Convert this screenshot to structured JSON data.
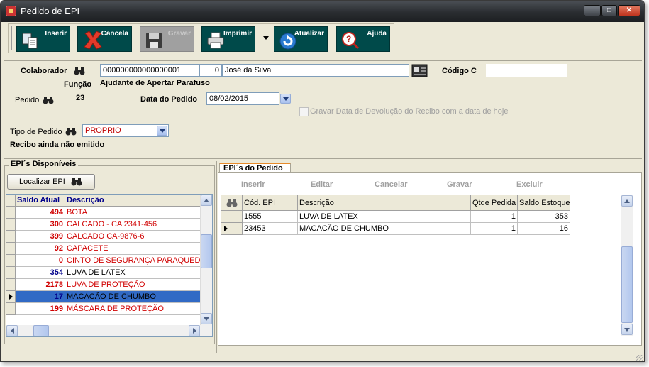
{
  "window": {
    "title": "Pedido de EPI"
  },
  "toolbar": {
    "buttons": [
      {
        "label": "Inserir",
        "enabled": true
      },
      {
        "label": "Cancela",
        "enabled": true
      },
      {
        "label": "Gravar",
        "enabled": false
      },
      {
        "label": "Imprimir",
        "enabled": true
      },
      {
        "label": "Atualizar",
        "enabled": true
      },
      {
        "label": "Ajuda",
        "enabled": true
      }
    ]
  },
  "form": {
    "colaborador_label": "Colaborador",
    "colaborador_code": "000000000000000001",
    "colaborador_digit": "0",
    "colaborador_name": "José da Silva",
    "codigo_label": "Código C",
    "codigo_value": "",
    "funcao_label": "Função",
    "funcao_value": "Ajudante de Apertar Parafuso",
    "pedido_label": "Pedido",
    "pedido_value": "23",
    "data_label": "Data do Pedido",
    "data_value": "08/02/2015",
    "gravar_label": "Gravar Data de Devolução do Recibo com a data de hoje",
    "tipo_label": "Tipo de Pedido",
    "tipo_value": "PROPRIO",
    "recibo_status": "Recibo ainda não emitido"
  },
  "left": {
    "title": "EPI´s Disponíveis",
    "localizar_label": "Localizar EPI",
    "columns": [
      "Saldo Atual",
      "Descrição"
    ],
    "rows": [
      {
        "saldo": "494",
        "desc": "BOTA",
        "red": true
      },
      {
        "saldo": "300",
        "desc": "CALCADO - CA 2341-456",
        "red": true
      },
      {
        "saldo": "399",
        "desc": "CALCADO CA-9876-6",
        "red": true
      },
      {
        "saldo": "92",
        "desc": "CAPACETE",
        "red": true
      },
      {
        "saldo": "0",
        "desc": "CINTO DE SEGURANÇA PARAQUEDI",
        "red": true
      },
      {
        "saldo": "354",
        "desc": "LUVA DE LATEX",
        "red": false
      },
      {
        "saldo": "2178",
        "desc": "LUVA DE PROTEÇÃO",
        "red": true
      },
      {
        "saldo": "17",
        "desc": "MACACÃO DE CHUMBO",
        "red": false,
        "selected": true
      },
      {
        "saldo": "199",
        "desc": "MÁSCARA DE PROTEÇÃO",
        "red": true
      }
    ]
  },
  "right": {
    "tab_label": "EPI´s do Pedido",
    "nav": [
      "Inserir",
      "Editar",
      "Cancelar",
      "Gravar",
      "Excluir"
    ],
    "columns": [
      "Cód. EPI",
      "Descrição",
      "Qtde Pedida",
      "Saldo Estoque"
    ],
    "rows": [
      {
        "cod": "1555",
        "desc": "LUVA DE LATEX",
        "qtde": "1",
        "saldo": "353"
      },
      {
        "cod": "23453",
        "desc": "MACACÃO DE CHUMBO",
        "qtde": "1",
        "saldo": "16",
        "current": true
      }
    ]
  }
}
